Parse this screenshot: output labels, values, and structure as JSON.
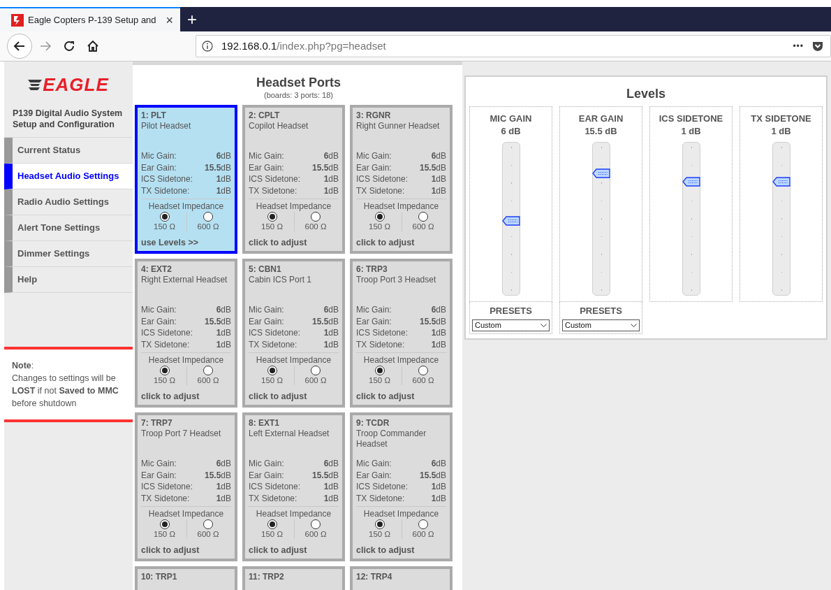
{
  "browser": {
    "tab_title": "Eagle Copters P-139 Setup and",
    "tab_close": "×",
    "new_tab": "+",
    "url_host": "192.168.0.1",
    "url_path": "/index.php?pg=headset",
    "menu_dots": "•••"
  },
  "sidebar": {
    "logo": "EAGLE",
    "subtitle": "P139 Digital Audio System Setup and Configuration",
    "items": [
      {
        "label": "Current Status",
        "selected": false
      },
      {
        "label": "Headset Audio Settings",
        "selected": true
      },
      {
        "label": "Radio Audio Settings",
        "selected": false
      },
      {
        "label": "Alert Tone Settings",
        "selected": false
      },
      {
        "label": "Dimmer Settings",
        "selected": false
      },
      {
        "label": "Help",
        "selected": false
      }
    ],
    "note_title": "**Note**:",
    "note_text": "Changes to settings will be **LOST** if not **Saved to MMC** before shutdown"
  },
  "ports_panel": {
    "title": "Headset Ports",
    "subtitle": "(boards: 3 ports: 18)",
    "ports": [
      {
        "title": "1: PLT",
        "name": "Pilot Headset",
        "stats": [
          {
            "label": "Mic Gain:",
            "value": "**6**dB"
          },
          {
            "label": "Ear Gain:",
            "value": "**15.5**dB"
          },
          {
            "label": "ICS Sidetone:",
            "value": "**1**dB"
          },
          {
            "label": "TX Sidetone:",
            "value": "**1**dB"
          }
        ],
        "impedance_label": "Headset Impedance",
        "impedance": [
          {
            "label": "150 Ω",
            "selected": true
          },
          {
            "label": "600 Ω",
            "selected": false
          }
        ],
        "footer": "use Levels >>",
        "selected": true
      },
      {
        "title": "2: CPLT",
        "name": "Copilot Headset",
        "stats": [
          {
            "label": "Mic Gain:",
            "value": "**6**dB"
          },
          {
            "label": "Ear Gain:",
            "value": "**15.5**dB"
          },
          {
            "label": "ICS Sidetone:",
            "value": "**1**dB"
          },
          {
            "label": "TX Sidetone:",
            "value": "**1**dB"
          }
        ],
        "impedance_label": "Headset Impedance",
        "impedance": [
          {
            "label": "150 Ω",
            "selected": true
          },
          {
            "label": "600 Ω",
            "selected": false
          }
        ],
        "footer": "click to adjust",
        "selected": false
      },
      {
        "title": "3: RGNR",
        "name": "Right Gunner Headset",
        "stats": [
          {
            "label": "Mic Gain:",
            "value": "**6**dB"
          },
          {
            "label": "Ear Gain:",
            "value": "**15.5**dB"
          },
          {
            "label": "ICS Sidetone:",
            "value": "**1**dB"
          },
          {
            "label": "TX Sidetone:",
            "value": "**1**dB"
          }
        ],
        "impedance_label": "Headset Impedance",
        "impedance": [
          {
            "label": "150 Ω",
            "selected": true
          },
          {
            "label": "600 Ω",
            "selected": false
          }
        ],
        "footer": "click to adjust",
        "selected": false
      },
      {
        "title": "4: EXT2",
        "name": "Right External Headset",
        "stats": [
          {
            "label": "Mic Gain:",
            "value": "**6**dB"
          },
          {
            "label": "Ear Gain:",
            "value": "**15.5**dB"
          },
          {
            "label": "ICS Sidetone:",
            "value": "**1**dB"
          },
          {
            "label": "TX Sidetone:",
            "value": "**1**dB"
          }
        ],
        "impedance_label": "Headset Impedance",
        "impedance": [
          {
            "label": "150 Ω",
            "selected": true
          },
          {
            "label": "600 Ω",
            "selected": false
          }
        ],
        "footer": "click to adjust",
        "selected": false
      },
      {
        "title": "5: CBN1",
        "name": "Cabin ICS Port 1",
        "stats": [
          {
            "label": "Mic Gain:",
            "value": "**6**dB"
          },
          {
            "label": "Ear Gain:",
            "value": "**15.5**dB"
          },
          {
            "label": "ICS Sidetone:",
            "value": "**1**dB"
          },
          {
            "label": "TX Sidetone:",
            "value": "**1**dB"
          }
        ],
        "impedance_label": "Headset Impedance",
        "impedance": [
          {
            "label": "150 Ω",
            "selected": true
          },
          {
            "label": "600 Ω",
            "selected": false
          }
        ],
        "footer": "click to adjust",
        "selected": false
      },
      {
        "title": "6: TRP3",
        "name": "Troop Port 3 Headset",
        "stats": [
          {
            "label": "Mic Gain:",
            "value": "**6**dB"
          },
          {
            "label": "Ear Gain:",
            "value": "**15.5**dB"
          },
          {
            "label": "ICS Sidetone:",
            "value": "**1**dB"
          },
          {
            "label": "TX Sidetone:",
            "value": "**1**dB"
          }
        ],
        "impedance_label": "Headset Impedance",
        "impedance": [
          {
            "label": "150 Ω",
            "selected": true
          },
          {
            "label": "600 Ω",
            "selected": false
          }
        ],
        "footer": "click to adjust",
        "selected": false
      },
      {
        "title": "7: TRP7",
        "name": "Troop Port 7 Headset",
        "stats": [
          {
            "label": "Mic Gain:",
            "value": "**6**dB"
          },
          {
            "label": "Ear Gain:",
            "value": "**15.5**dB"
          },
          {
            "label": "ICS Sidetone:",
            "value": "**1**dB"
          },
          {
            "label": "TX Sidetone:",
            "value": "**1**dB"
          }
        ],
        "impedance_label": "Headset Impedance",
        "impedance": [
          {
            "label": "150 Ω",
            "selected": true
          },
          {
            "label": "600 Ω",
            "selected": false
          }
        ],
        "footer": "click to adjust",
        "selected": false
      },
      {
        "title": "8: EXT1",
        "name": "Left External Headset",
        "stats": [
          {
            "label": "Mic Gain:",
            "value": "**6**dB"
          },
          {
            "label": "Ear Gain:",
            "value": "**15.5**dB"
          },
          {
            "label": "ICS Sidetone:",
            "value": "**1**dB"
          },
          {
            "label": "TX Sidetone:",
            "value": "**1**dB"
          }
        ],
        "impedance_label": "Headset Impedance",
        "impedance": [
          {
            "label": "150 Ω",
            "selected": true
          },
          {
            "label": "600 Ω",
            "selected": false
          }
        ],
        "footer": "click to adjust",
        "selected": false
      },
      {
        "title": "9: TCDR",
        "name": "Troop Commander Headset",
        "stats": [
          {
            "label": "Mic Gain:",
            "value": "**6**dB"
          },
          {
            "label": "Ear Gain:",
            "value": "**15.5**dB"
          },
          {
            "label": "ICS Sidetone:",
            "value": "**1**dB"
          },
          {
            "label": "TX Sidetone:",
            "value": "**1**dB"
          }
        ],
        "impedance_label": "Headset Impedance",
        "impedance": [
          {
            "label": "150 Ω",
            "selected": true
          },
          {
            "label": "600 Ω",
            "selected": false
          }
        ],
        "footer": "click to adjust",
        "selected": false
      },
      {
        "title": "10: TRP1",
        "selected": false
      },
      {
        "title": "11: TRP2",
        "selected": false
      },
      {
        "title": "12: TRP4",
        "selected": false
      }
    ]
  },
  "levels_panel": {
    "title": "Levels",
    "channels": [
      {
        "label": "MIC GAIN",
        "reading": "6 dB",
        "level": 0.49,
        "presets_label": "PRESETS",
        "preset": "Custom"
      },
      {
        "label": "EAR GAIN",
        "reading": "15.5 dB",
        "level": 0.82,
        "presets_label": "PRESETS",
        "preset": "Custom"
      },
      {
        "label": "ICS SIDETONE",
        "reading": "1 dB",
        "level": 0.76
      },
      {
        "label": "TX SIDETONE",
        "reading": "1 dB",
        "level": 0.76
      }
    ]
  }
}
